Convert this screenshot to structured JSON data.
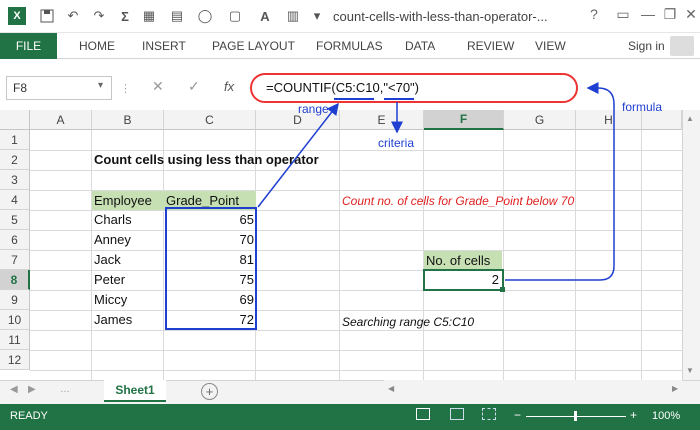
{
  "titlebar": {
    "doc_title": "count-cells-with-less-than-operator-...",
    "help": "?",
    "minimize": "—",
    "restore": "❐",
    "close": "✕"
  },
  "ribbon": {
    "tabs": [
      "FILE",
      "HOME",
      "INSERT",
      "PAGE LAYOUT",
      "FORMULAS",
      "DATA",
      "REVIEW",
      "VIEW"
    ],
    "signin": "Sign in"
  },
  "formula_bar": {
    "name_box": "F8",
    "fx": "fx",
    "formula": "=COUNTIF(C5:C10,\"<70\")"
  },
  "grid": {
    "columns": [
      "A",
      "B",
      "C",
      "D",
      "E",
      "F",
      "G",
      "H"
    ],
    "rows": [
      "1",
      "2",
      "3",
      "4",
      "5",
      "6",
      "7",
      "8",
      "9",
      "10",
      "11",
      "12"
    ],
    "heading": "Count cells using less than operator",
    "header_employee": "Employee",
    "header_grade": "Grade_Point",
    "employees": [
      "Charls",
      "Anney",
      "Jack",
      "Peter",
      "Miccy",
      "James"
    ],
    "grades": [
      "65",
      "70",
      "81",
      "75",
      "69",
      "72"
    ],
    "note_count": "Count no. of cells for Grade_Point below 70",
    "note_range": "Searching range C5:C10",
    "result_label": "No. of cells",
    "result_value": "2"
  },
  "annotations": {
    "range": "range",
    "criteria": "criteria",
    "formula": "formula"
  },
  "sheets": {
    "active": "Sheet1"
  },
  "status": {
    "ready": "READY",
    "zoom": "100%"
  },
  "colors": {
    "excel_green": "#217346",
    "label_fill": "#c6e0b4",
    "annotation_blue": "#1f3fd1",
    "oval_red": "#e33333",
    "note_red": "#e02020"
  }
}
